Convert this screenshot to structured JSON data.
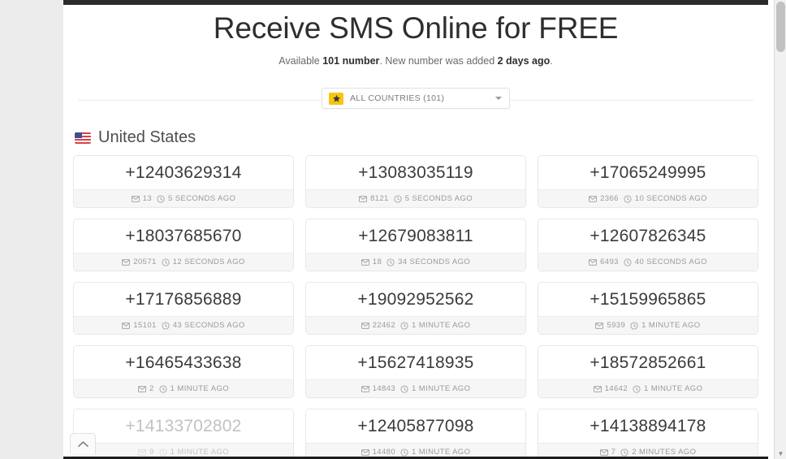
{
  "header": {
    "title": "Receive SMS Online for FREE",
    "subtitle_prefix": "Available ",
    "subtitle_count": "101 number",
    "subtitle_middle": ". New number was added ",
    "subtitle_time": "2 days ago",
    "subtitle_suffix": "."
  },
  "country_select": {
    "label": "ALL COUNTRIES (101)",
    "star_color": "#f8c413",
    "icon": "star-icon",
    "caret_icon": "chevron-down-icon"
  },
  "country_section": {
    "name": "United States",
    "flag": "us-flag-icon"
  },
  "cards": [
    {
      "number": "+12403629314",
      "messages": "13",
      "time": "5 SECONDS AGO",
      "dim": false
    },
    {
      "number": "+13083035119",
      "messages": "8121",
      "time": "5 SECONDS AGO",
      "dim": false
    },
    {
      "number": "+17065249995",
      "messages": "2366",
      "time": "10 SECONDS AGO",
      "dim": false
    },
    {
      "number": "+18037685670",
      "messages": "20571",
      "time": "12 SECONDS AGO",
      "dim": false
    },
    {
      "number": "+12679083811",
      "messages": "18",
      "time": "34 SECONDS AGO",
      "dim": false
    },
    {
      "number": "+12607826345",
      "messages": "6493",
      "time": "40 SECONDS AGO",
      "dim": false
    },
    {
      "number": "+17176856889",
      "messages": "15101",
      "time": "43 SECONDS AGO",
      "dim": false
    },
    {
      "number": "+19092952562",
      "messages": "22462",
      "time": "1 MINUTE AGO",
      "dim": false
    },
    {
      "number": "+15159965865",
      "messages": "5939",
      "time": "1 MINUTE AGO",
      "dim": false
    },
    {
      "number": "+16465433638",
      "messages": "2",
      "time": "1 MINUTE AGO",
      "dim": false
    },
    {
      "number": "+15627418935",
      "messages": "14843",
      "time": "1 MINUTE AGO",
      "dim": false
    },
    {
      "number": "+18572852661",
      "messages": "14642",
      "time": "1 MINUTE AGO",
      "dim": false
    },
    {
      "number": "+14133702802",
      "messages": "9",
      "time": "1 MINUTE AGO",
      "dim": true
    },
    {
      "number": "+12405877098",
      "messages": "14480",
      "time": "1 MINUTE AGO",
      "dim": false
    },
    {
      "number": "+14138894178",
      "messages": "7",
      "time": "2 MINUTES AGO",
      "dim": false
    }
  ],
  "scroll_top_button": {
    "icon": "chevron-up-icon"
  },
  "scrollbar": {
    "down_arrow_icon": "caret-down-icon"
  }
}
